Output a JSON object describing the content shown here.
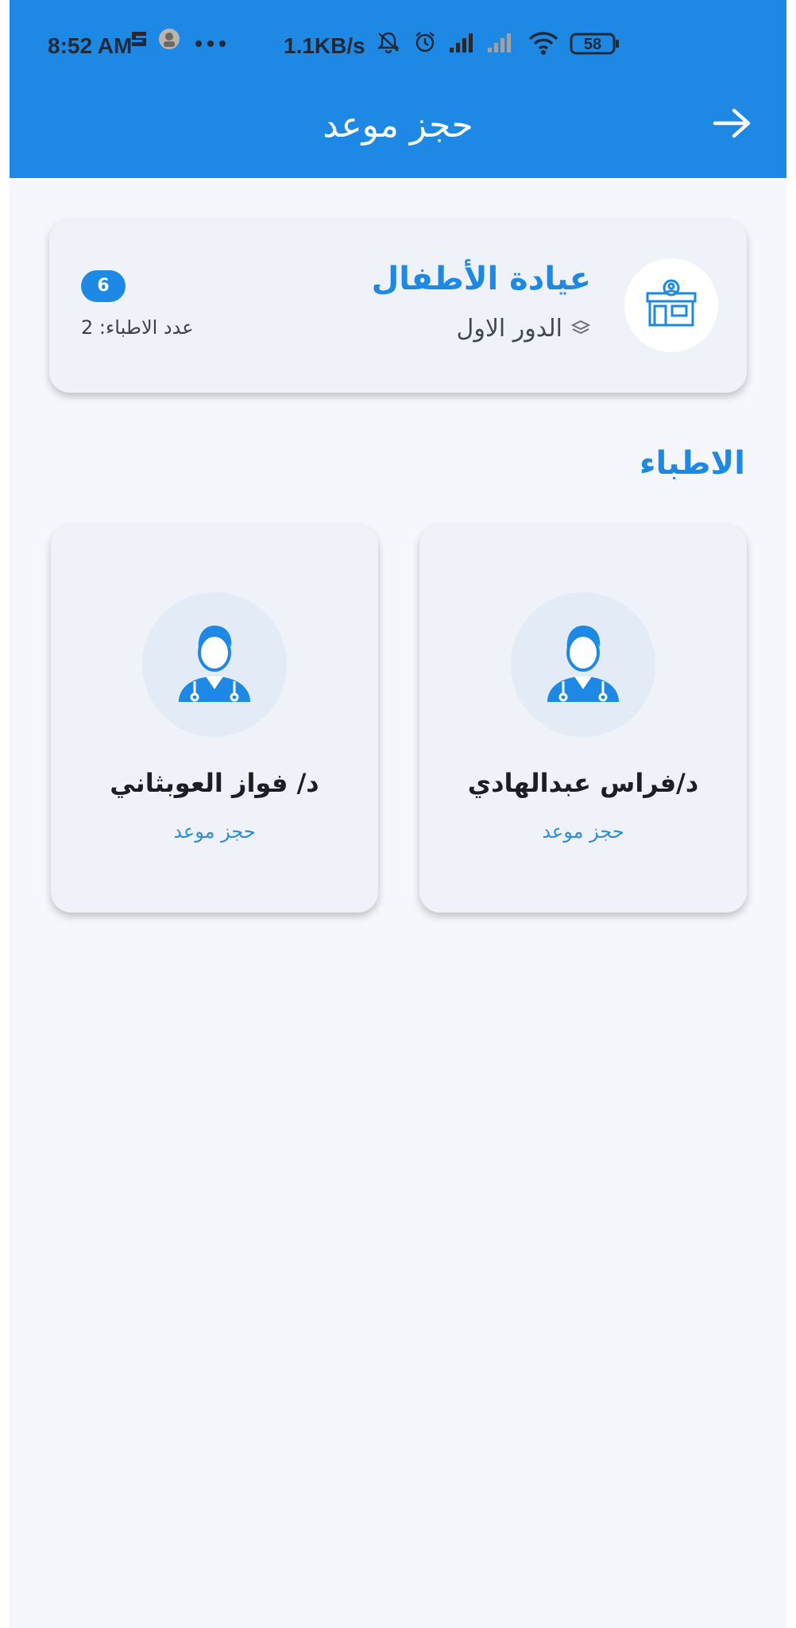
{
  "status_bar": {
    "time": "8:52 AM",
    "network_speed": "1.1KB/s",
    "battery": "58",
    "icons": [
      "s-icon",
      "avatar-icon",
      "more-dots-icon",
      "bell-off-icon",
      "alarm-icon",
      "signal-icon",
      "signal-weak-icon",
      "wifi-icon",
      "battery-icon"
    ]
  },
  "app_bar": {
    "title": "حجز موعد",
    "back_icon": "arrow-right-icon",
    "color": "#1e88e5"
  },
  "clinic": {
    "name": "عيادة الأطفال",
    "floor": "الدور الاول",
    "badge": "6",
    "doctors_count": "عدد الاطباء: 2",
    "icon": "clinic-building-icon"
  },
  "doctors_section": {
    "title": "الاطباء",
    "doctors": [
      {
        "name": "د/فراس عبدالهادي",
        "action": "حجز موعد",
        "icon": "doctor-icon"
      },
      {
        "name": "د/ فواز العوبثاني",
        "action": "حجز موعد",
        "icon": "doctor-icon"
      }
    ]
  },
  "colors": {
    "accent": "#1e88e5",
    "background": "#f5f7fc",
    "card": "#eff2f9"
  }
}
